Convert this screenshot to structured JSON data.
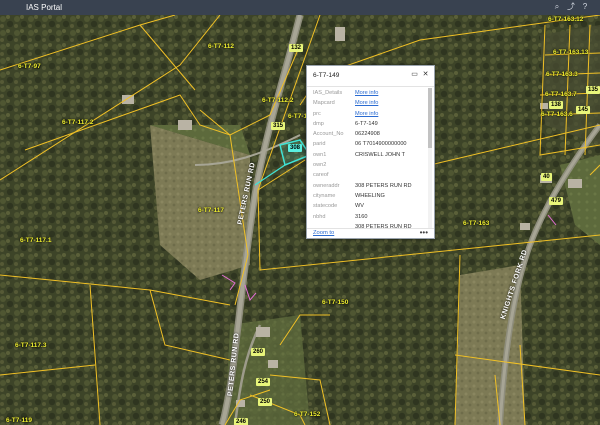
{
  "app": {
    "title": "IAS Portal"
  },
  "popup": {
    "title": "6-T7-149",
    "rows": [
      {
        "key": "IAS_Details",
        "value": "More info",
        "link": true
      },
      {
        "key": "Mapcard",
        "value": "More info",
        "link": true
      },
      {
        "key": "prc",
        "value": "More info",
        "link": true
      },
      {
        "key": "dmp",
        "value": "6-T7-149",
        "link": false
      },
      {
        "key": "Account_No",
        "value": "06224908",
        "link": false
      },
      {
        "key": "parid",
        "value": "06 T7014900000000",
        "link": false
      },
      {
        "key": "own1",
        "value": "CRISWELL JOHN T",
        "link": false
      },
      {
        "key": "own2",
        "value": "",
        "link": false
      },
      {
        "key": "careof",
        "value": "",
        "link": false
      },
      {
        "key": "owneraddr",
        "value": "308 PETERS RUN RD",
        "link": false
      },
      {
        "key": "cityname",
        "value": "WHEELING",
        "link": false
      },
      {
        "key": "statecode",
        "value": "WV",
        "link": false
      },
      {
        "key": "nbhd",
        "value": "3160",
        "link": false
      },
      {
        "key": "",
        "value": "308 PETERS RUN RD",
        "link": false
      }
    ],
    "zoom_label": "Zoom to",
    "more_label": "•••"
  },
  "parcel_labels": [
    "6-T7-97",
    "6-T7-112",
    "6-T7-112.2",
    "6-T7-14",
    "6-T7-117.2",
    "6-T7-117",
    "6-T7-117.1",
    "6-T7-117.3",
    "6-T7-150",
    "6-T7-163",
    "6-T7-152",
    "6-T7-119",
    "6-T7-163.12",
    "6-T7-163.13",
    "6-T7-163.3",
    "6-T7-163.6",
    "6-T7-163.7"
  ],
  "address_labels": [
    "132",
    "308",
    "315",
    "260",
    "254",
    "250",
    "246",
    "40",
    "479",
    "135",
    "138",
    "145"
  ],
  "road_labels": [
    "PETERS RUN RD",
    "PETERS RUN RD",
    "KNIGHTS FORK RD"
  ]
}
